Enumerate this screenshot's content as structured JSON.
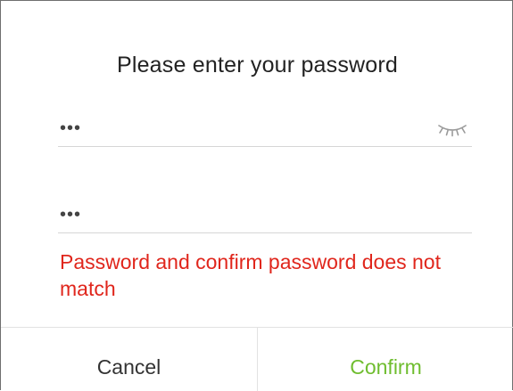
{
  "dialog": {
    "title": "Please enter your password",
    "password_field": {
      "value": "•••",
      "visibility_icon": "eye-closed-icon"
    },
    "confirm_field": {
      "value": "•••"
    },
    "error_message": "Password and confirm password does not match",
    "buttons": {
      "cancel_label": "Cancel",
      "confirm_label": "Confirm"
    }
  },
  "colors": {
    "error": "#e0261c",
    "confirm_accent": "#6fbd2f",
    "text": "#222222",
    "divider": "#e2e2e2"
  }
}
